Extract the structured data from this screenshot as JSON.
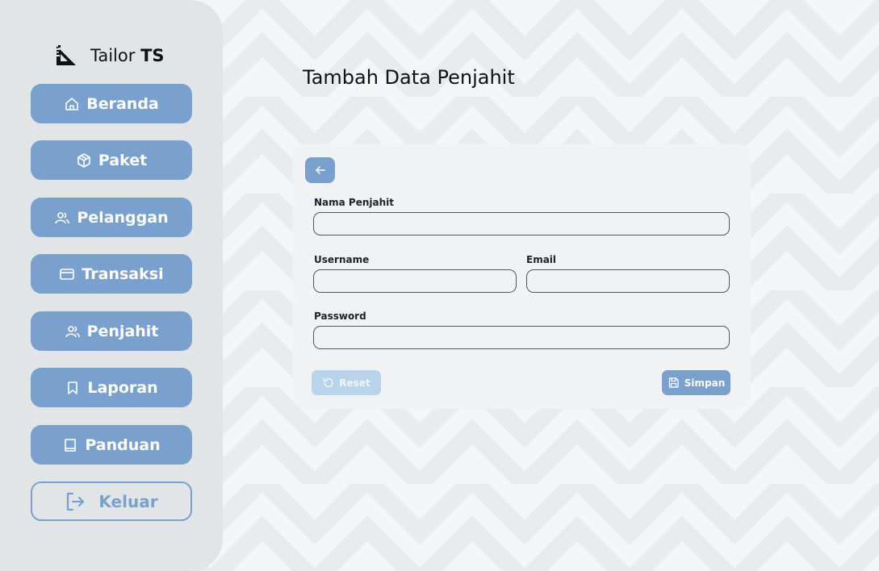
{
  "app": {
    "brand_name": "Tailor",
    "brand_bold": "TS"
  },
  "sidebar": {
    "items": [
      {
        "label": "Beranda",
        "icon": "home-icon"
      },
      {
        "label": "Paket",
        "icon": "package-icon"
      },
      {
        "label": "Pelanggan",
        "icon": "users-icon"
      },
      {
        "label": "Transaksi",
        "icon": "credit-card-icon"
      },
      {
        "label": "Penjahit",
        "icon": "users-icon"
      },
      {
        "label": "Laporan",
        "icon": "bookmark-icon"
      },
      {
        "label": "Panduan",
        "icon": "book-icon"
      }
    ],
    "logout_label": "Keluar"
  },
  "page": {
    "title": "Tambah Data Penjahit"
  },
  "form": {
    "name_label": "Nama Penjahit",
    "name_value": "",
    "username_label": "Username",
    "username_value": "",
    "email_label": "Email",
    "email_value": "",
    "password_label": "Password",
    "password_value": "",
    "reset_label": "Reset",
    "save_label": "Simpan"
  },
  "colors": {
    "accent": "#7aa0cd",
    "accent_light": "#b9d3ea",
    "sidebar_bg": "#e1e5e7",
    "card_bg": "#f1f2f4"
  }
}
